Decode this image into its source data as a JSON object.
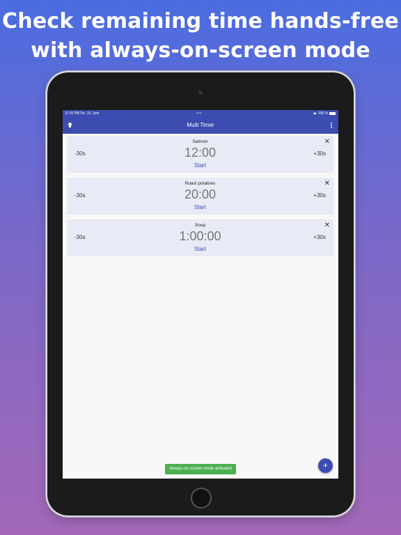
{
  "headline": {
    "line1": "Check remaining time hands-free",
    "line2": "with always-on-screen mode"
  },
  "statusbar": {
    "time_date": "11:25 PM  Do. 15. Juni",
    "center": "•••",
    "battery": "100 %"
  },
  "appbar": {
    "title": "Multi Timer",
    "left_icon": "lightbulb-icon",
    "right_icon": "more-vertical-icon"
  },
  "timers": [
    {
      "name": "Salmon",
      "time": "12:00",
      "minus": "-30s",
      "plus": "+30s",
      "start": "Start",
      "close": "✕"
    },
    {
      "name": "Roast potatoes",
      "time": "20:00",
      "minus": "-30s",
      "plus": "+30s",
      "start": "Start",
      "close": "✕"
    },
    {
      "name": "Soup",
      "time": "1:00:00",
      "minus": "-30s",
      "plus": "+30s",
      "start": "Start",
      "close": "✕"
    }
  ],
  "snackbar": {
    "text": "Always-on screen mode activated",
    "color": "#4caf50"
  },
  "fab": {
    "label": "+",
    "color": "#3c4cb0"
  },
  "colors": {
    "accent": "#3c4cb0",
    "card": "#e8eaf6"
  }
}
